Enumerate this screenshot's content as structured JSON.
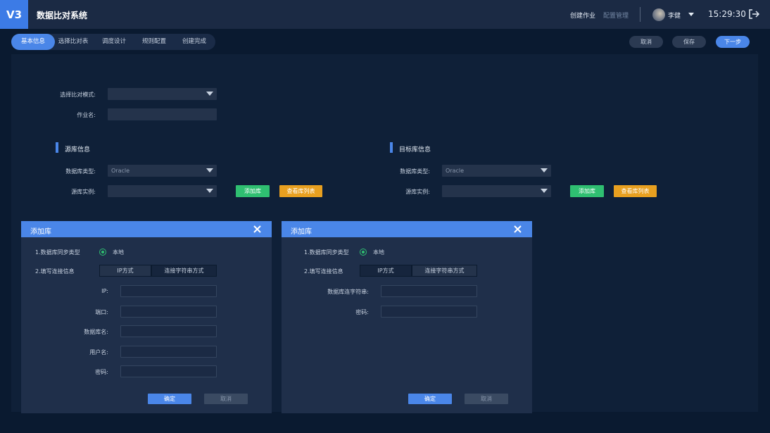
{
  "header": {
    "logo": "V3",
    "app_title": "数据比对系统",
    "nav_create": "创建作业",
    "nav_config": "配置管理",
    "user_name": "李健",
    "time": "15:29:30"
  },
  "steps": [
    "基本信息",
    "选择比对表",
    "调度设计",
    "规则配置",
    "创建完成"
  ],
  "actions": {
    "cancel": "取消",
    "save": "保存",
    "next": "下一步"
  },
  "form": {
    "compare_mode_label": "选择比对模式:",
    "compare_mode_value": "",
    "job_name_label": "作业名:",
    "job_name_value": ""
  },
  "source": {
    "title": "源库信息",
    "db_type_label": "数据库类型:",
    "db_type_value": "Oracle",
    "instance_label": "源库实例:",
    "instance_value": "",
    "add_button": "添加库",
    "view_button": "查看库列表"
  },
  "target": {
    "title": "目标库信息",
    "db_type_label": "数据库类型:",
    "db_type_value": "Oracle",
    "instance_label": "源库实例:",
    "instance_value": "",
    "add_button": "添加库",
    "view_button": "查看库列表"
  },
  "dialog_ip": {
    "title": "添加库",
    "sync_type_label": "1.数据库同步类型",
    "sync_type_option": "本地",
    "conn_info_label": "2.填写连接信息",
    "mode_ip": "IP方式",
    "mode_conn_str": "连接字符串方式",
    "fields": [
      {
        "label": "IP:",
        "value": ""
      },
      {
        "label": "端口:",
        "value": ""
      },
      {
        "label": "数据库名:",
        "value": ""
      },
      {
        "label": "用户名:",
        "value": ""
      },
      {
        "label": "密码:",
        "value": ""
      }
    ],
    "confirm": "确定",
    "cancel": "取消"
  },
  "dialog_conn": {
    "title": "添加库",
    "sync_type_label": "1.数据库同步类型",
    "sync_type_option": "本地",
    "conn_info_label": "2.填写连接信息",
    "mode_ip": "IP方式",
    "mode_conn_str": "连接字符串方式",
    "fields": [
      {
        "label": "数据库连字符串:",
        "value": ""
      },
      {
        "label": "密码:",
        "value": ""
      }
    ],
    "confirm": "确定",
    "cancel": "取消"
  },
  "colors": {
    "accent": "#4a86e8",
    "green": "#2fbf71",
    "orange": "#e8a020",
    "header_bg": "#1b2a44",
    "page_bg": "#0a1a30"
  }
}
